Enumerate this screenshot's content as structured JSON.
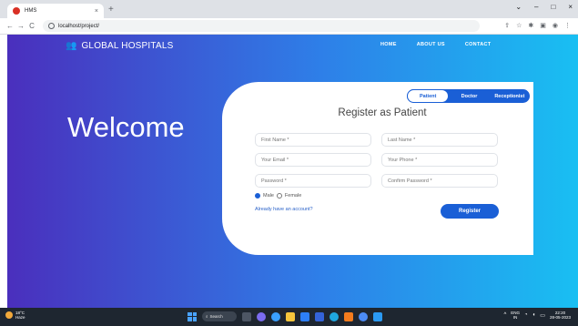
{
  "browser": {
    "tab_title": "HMS",
    "tab_close": "×",
    "new_tab": "+",
    "url": "localhost/project/",
    "window_controls": [
      "⌄",
      "–",
      "□",
      "×"
    ],
    "toolbar_icons": [
      "share-icon",
      "star-icon",
      "extensions-icon",
      "sidebar-icon",
      "profile-icon",
      "menu-icon"
    ]
  },
  "site": {
    "brand": "GLOBAL HOSPITALS",
    "nav": [
      "HOME",
      "ABOUT US",
      "CONTACT"
    ],
    "welcome": "Welcome"
  },
  "form": {
    "roles": [
      "Patient",
      "Doctor",
      "Receptionist"
    ],
    "active_role": "Patient",
    "title": "Register as Patient",
    "fields": {
      "first_name": "First Name *",
      "last_name": "Last Name *",
      "email": "Your Email *",
      "phone": "Your Phone *",
      "password": "Password *",
      "confirm_password": "Confirm Password *"
    },
    "gender": {
      "male": "Male",
      "female": "Female",
      "selected": "Male"
    },
    "login_link": "Already have an account?",
    "submit": "Register"
  },
  "taskbar": {
    "weather_temp": "18°C",
    "weather_desc": "Haze",
    "search": "Search",
    "lang": "ENG",
    "region": "IN",
    "time": "22:20",
    "date": "28-05-2023"
  },
  "colors": {
    "accent": "#1a5fd6",
    "gradient_start": "#4a2fbd",
    "gradient_end": "#19bff2"
  }
}
